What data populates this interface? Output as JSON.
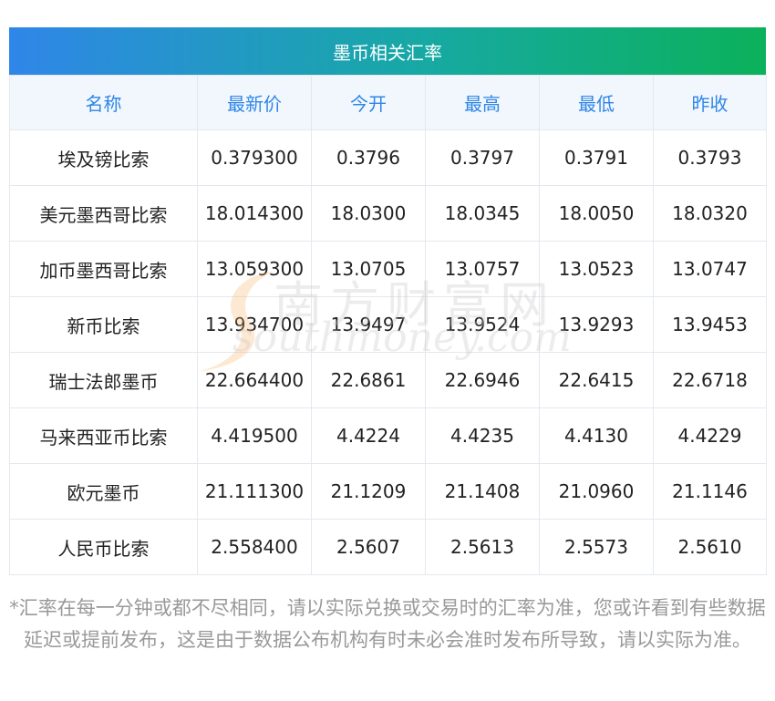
{
  "card": {
    "title": "墨币相关汇率",
    "headers": [
      "名称",
      "最新价",
      "今开",
      "最高",
      "最低",
      "昨收"
    ],
    "rows": [
      {
        "name": "埃及镑比索",
        "latest": "0.379300",
        "open": "0.3796",
        "high": "0.3797",
        "low": "0.3791",
        "prev_close": "0.3793"
      },
      {
        "name": "美元墨西哥比索",
        "latest": "18.014300",
        "open": "18.0300",
        "high": "18.0345",
        "low": "18.0050",
        "prev_close": "18.0320"
      },
      {
        "name": "加币墨西哥比索",
        "latest": "13.059300",
        "open": "13.0705",
        "high": "13.0757",
        "low": "13.0523",
        "prev_close": "13.0747"
      },
      {
        "name": "新币比索",
        "latest": "13.934700",
        "open": "13.9497",
        "high": "13.9524",
        "low": "13.9293",
        "prev_close": "13.9453"
      },
      {
        "name": "瑞士法郎墨币",
        "latest": "22.664400",
        "open": "22.6861",
        "high": "22.6946",
        "low": "22.6415",
        "prev_close": "22.6718"
      },
      {
        "name": "马来西亚币比索",
        "latest": "4.419500",
        "open": "4.4224",
        "high": "4.4235",
        "low": "4.4130",
        "prev_close": "4.4229"
      },
      {
        "name": "欧元墨币",
        "latest": "21.111300",
        "open": "21.1209",
        "high": "21.1408",
        "low": "21.0960",
        "prev_close": "21.1146"
      },
      {
        "name": "人民币比索",
        "latest": "2.558400",
        "open": "2.5607",
        "high": "2.5613",
        "low": "2.5573",
        "prev_close": "2.5610"
      }
    ]
  },
  "watermark": {
    "cn": "南方财富网",
    "en": "southmoney.com"
  },
  "footnote": "*汇率在每一分钟或都不尽相同，请以实际兑换或交易时的汇率为准，您或许看到有些数据延迟或提前发布，这是由于数据公布机构有时未必会准时发布所导致，请以实际为准。",
  "colors": {
    "title_gradient_start": "#2f86e8",
    "title_gradient_end": "#0bb15a",
    "header_text": "#2f86e8",
    "header_bg": "#f1f7fd",
    "footnote_text": "#999999"
  }
}
